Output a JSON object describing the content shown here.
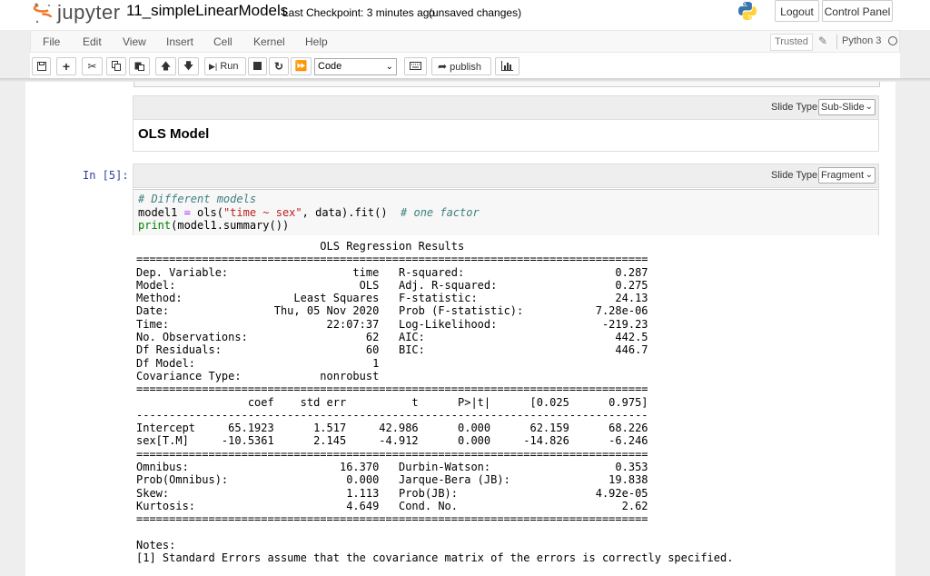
{
  "header": {
    "logo_text": "jupyter",
    "notebook_title": "11_simpleLinearModels",
    "checkpoint": "Last Checkpoint: 3 minutes ago",
    "unsaved": "(unsaved changes)",
    "logout_label": "Logout",
    "control_panel_label": "Control Panel"
  },
  "menubar": {
    "items": [
      "File",
      "Edit",
      "View",
      "Insert",
      "Cell",
      "Kernel",
      "Help"
    ],
    "trusted": "Trusted",
    "kernel": "Python 3"
  },
  "toolbar": {
    "run_label": "Run",
    "cell_type": "Code",
    "publish_label": "publish"
  },
  "md_cell": {
    "slide_type_label": "Slide Type",
    "slide_type": "Sub-Slide",
    "heading": "OLS Model"
  },
  "code_cell": {
    "prompt": "In [5]:",
    "slide_type_label": "Slide Type",
    "slide_type": "Fragment",
    "code": {
      "line1": "# Different models",
      "line2_a": "model1 ",
      "line2_op": "=",
      "line2_b": " ols(",
      "line2_str": "\"time ~ sex\"",
      "line2_c": ", data).fit()  ",
      "line2_cm": "# one factor",
      "line3_fn": "print",
      "line3_rest": "(model1.summary())"
    }
  },
  "output": {
    "text": "                            OLS Regression Results                            \n==============================================================================\nDep. Variable:                   time   R-squared:                       0.287\nModel:                            OLS   Adj. R-squared:                  0.275\nMethod:                 Least Squares   F-statistic:                     24.13\nDate:                Thu, 05 Nov 2020   Prob (F-statistic):           7.28e-06\nTime:                        22:07:37   Log-Likelihood:                -219.23\nNo. Observations:                  62   AIC:                             442.5\nDf Residuals:                      60   BIC:                             446.7\nDf Model:                           1                                         \nCovariance Type:            nonrobust                                         \n==============================================================================\n                 coef    std err          t      P>|t|      [0.025      0.975]\n------------------------------------------------------------------------------\nIntercept     65.1923      1.517     42.986      0.000      62.159      68.226\nsex[T.M]     -10.5361      2.145     -4.912      0.000     -14.826      -6.246\n==============================================================================\nOmnibus:                       16.370   Durbin-Watson:                   0.353\nProb(Omnibus):                  0.000   Jarque-Bera (JB):               19.838\nSkew:                           1.113   Prob(JB):                     4.92e-05\nKurtosis:                       4.649   Cond. No.                         2.62\n==============================================================================\n\nNotes:\n[1] Standard Errors assume that the covariance matrix of the errors is correctly specified."
  },
  "colors": {
    "accent_orange": "#f37726",
    "prompt_blue": "#303f9f",
    "comment": "#408080",
    "string": "#ba2121"
  }
}
